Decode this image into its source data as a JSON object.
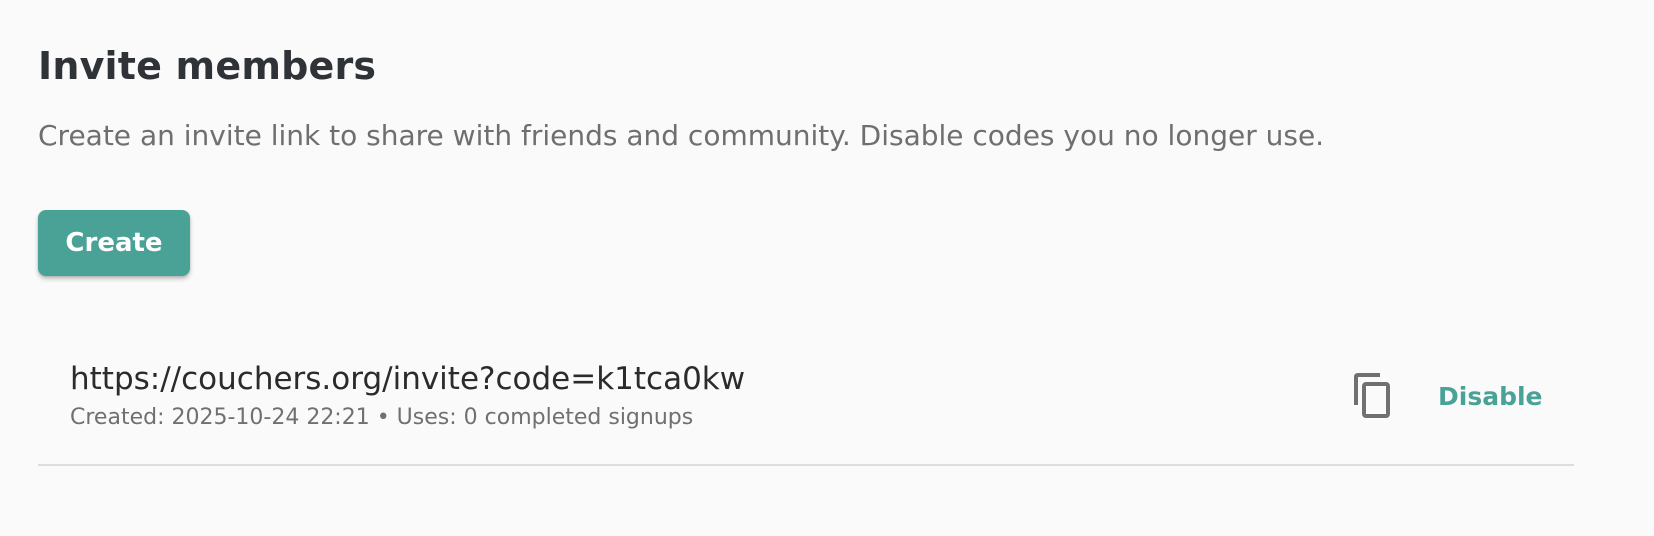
{
  "invite_section": {
    "title": "Invite members",
    "description": "Create an invite link to share with friends and community. Disable codes you no longer use.",
    "create_label": "Create"
  },
  "invites": [
    {
      "url": "https://couchers.org/invite?code=k1tca0kw",
      "meta": "Created: 2025-10-24 22:21 • Uses: 0 completed signups",
      "copy_icon": "copy-icon",
      "disable_label": "Disable"
    }
  ],
  "colors": {
    "accent": "#4aa297",
    "background": "#fafafa",
    "text_primary": "#2f3237",
    "text_secondary": "#6f6f6f",
    "divider": "#dddddd",
    "icon": "#707070"
  }
}
